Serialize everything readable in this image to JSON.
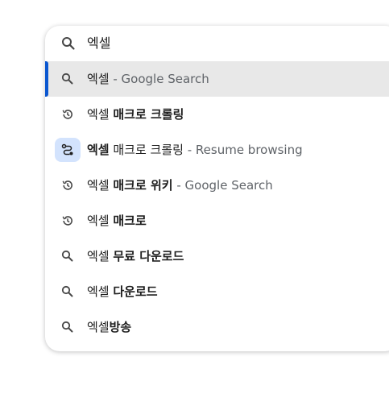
{
  "omnibox": {
    "query": "엑셀",
    "suggestions": [
      {
        "prefix": "엑셀",
        "bold": "",
        "suffix": " - Google Search",
        "icon": "search-icon",
        "selected": true
      },
      {
        "prefix": "엑셀 ",
        "bold": "매크로 크롤링",
        "suffix": "",
        "icon": "history-icon"
      },
      {
        "prefix": "엑셀",
        "bold": "",
        "suffix_plain": " 매크로 크롤링",
        "suffix": " - Resume browsing",
        "icon": "journey-icon"
      },
      {
        "prefix": "엑셀 ",
        "bold": "매크로 위키",
        "suffix": " - Google Search",
        "icon": "history-icon"
      },
      {
        "prefix": "엑셀 ",
        "bold": "매크로",
        "suffix": "",
        "icon": "history-icon"
      },
      {
        "prefix": "엑셀 ",
        "bold": "무료 다운로드",
        "suffix": "",
        "icon": "search-icon"
      },
      {
        "prefix": "엑셀 ",
        "bold": "다운로드",
        "suffix": "",
        "icon": "search-icon"
      },
      {
        "prefix": "엑셀",
        "bold": "방송",
        "suffix": "",
        "icon": "search-icon"
      }
    ]
  }
}
